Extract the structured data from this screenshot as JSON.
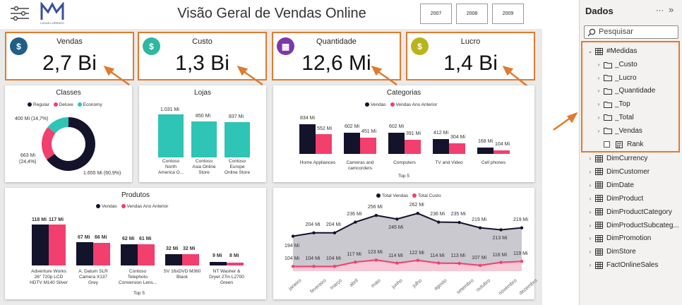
{
  "header": {
    "title": "Visão Geral de Vendas Online",
    "logo_text": "LUKAS LORENZO",
    "years": [
      "2007",
      "2008",
      "2009"
    ]
  },
  "kpis": [
    {
      "label": "Vendas",
      "value": "2,7 Bi",
      "icon": "dollar-icon",
      "color": "#1f5f87"
    },
    {
      "label": "Custo",
      "value": "1,3 Bi",
      "icon": "money-out-icon",
      "color": "#2fb7a0"
    },
    {
      "label": "Quantidade",
      "value": "12,6 Mi",
      "icon": "boxes-icon",
      "color": "#7a3aa8"
    },
    {
      "label": "Lucro",
      "value": "1,4 Bi",
      "icon": "profit-icon",
      "color": "#b7b51a"
    }
  ],
  "colors": {
    "regular": "#13132b",
    "deluxe": "#f23f6d",
    "economy": "#2ec4b6",
    "accent": "#e07b2e",
    "line_area": "#c9c9cf"
  },
  "classes": {
    "title": "Classes",
    "legend": [
      "Regular",
      "Deluxe",
      "Economy"
    ],
    "labels": [
      "400 Mi (14,7%)",
      "663 Mi",
      "(24,4%)",
      "1.655 Mi (60,9%)"
    ]
  },
  "lojas": {
    "title": "Lojas",
    "values": [
      "1.031 Mi",
      "850 Mi",
      "837 Mi"
    ],
    "categories": [
      [
        "Contoso",
        "North",
        "America O..."
      ],
      [
        "Contoso",
        "Asia Online",
        "Store"
      ],
      [
        "Contoso",
        "Europe",
        "Online Store"
      ]
    ]
  },
  "categorias": {
    "title": "Categorias",
    "legend": [
      "Vendas",
      "Vendas Ano Anterior"
    ],
    "groups": [
      {
        "name": [
          "Home Appliances"
        ],
        "a": "834 Mi",
        "b": "552 Mi"
      },
      {
        "name": [
          "Cameras and",
          "camcorders"
        ],
        "a": "602 Mi",
        "b": "451 Mi"
      },
      {
        "name": [
          "Computers"
        ],
        "a": "602 Mi",
        "b": "391 Mi"
      },
      {
        "name": [
          "TV and Video"
        ],
        "a": "412 Mi",
        "b": "304 Mi"
      },
      {
        "name": [
          "Cell phones"
        ],
        "a": "168 Mi",
        "b": "104 Mi"
      }
    ],
    "footer": "Top 5"
  },
  "produtos": {
    "title": "Produtos",
    "legend": [
      "Vendas",
      "Vendas Ano Anterior"
    ],
    "groups": [
      {
        "name": [
          "Adventure Works",
          "26\" 720p LCD",
          "HDTV M140 Silver"
        ],
        "a": "118 Mi",
        "b": "117 Mi"
      },
      {
        "name": [
          "A. Datum SLR",
          "Camera X137",
          "Grey"
        ],
        "a": "67 Mi",
        "b": "66 Mi"
      },
      {
        "name": [
          "Contoso",
          "Telephoto",
          "Conversion Lens..."
        ],
        "a": "62 Mi",
        "b": "61 Mi"
      },
      {
        "name": [
          "SV 16xDVD M360",
          "Black"
        ],
        "a": "32 Mi",
        "b": "32 Mi"
      },
      {
        "name": [
          "NT Washer &",
          "Dryer 27in L2700",
          "Green"
        ],
        "a": "9 Mi",
        "b": "8 Mi"
      }
    ],
    "footer": "Top 5"
  },
  "mensal": {
    "legend": [
      "Total Vendas",
      "Total Custo"
    ],
    "months": [
      "janeiro",
      "fevereiro",
      "março",
      "abril",
      "maio",
      "junho",
      "julho",
      "agosto",
      "setembro",
      "outubro",
      "novembro",
      "dezembro"
    ],
    "vendas_labels": [
      "194 Mi",
      "204 Mi",
      "204 Mi",
      "236 Mi",
      "256 Mi",
      "245 Mi",
      "262 Mi",
      "236 Mi",
      "235 Mi",
      "219 Mi",
      "213 Mi",
      "219 Mi"
    ],
    "custo_labels": [
      "104 Mi",
      "104 Mi",
      "104 Mi",
      "117 Mi",
      "123 Mi",
      "114 Mi",
      "122 Mi",
      "114 Mi",
      "113 Mi",
      "107 Mi",
      "116 Mi",
      "119 Mi"
    ]
  },
  "chart_data": [
    {
      "type": "pie",
      "title": "Classes",
      "categories": [
        "Regular",
        "Deluxe",
        "Economy"
      ],
      "values": [
        1655,
        663,
        400
      ],
      "unit": "Mi"
    },
    {
      "type": "bar",
      "title": "Lojas",
      "categories": [
        "Contoso North America O...",
        "Contoso Asia Online Store",
        "Contoso Europe Online Store"
      ],
      "values": [
        1031,
        850,
        837
      ],
      "unit": "Mi"
    },
    {
      "type": "bar",
      "title": "Categorias",
      "categories": [
        "Home Appliances",
        "Cameras and camcorders",
        "Computers",
        "TV and Video",
        "Cell phones"
      ],
      "series": [
        {
          "name": "Vendas",
          "values": [
            834,
            602,
            602,
            412,
            168
          ]
        },
        {
          "name": "Vendas Ano Anterior",
          "values": [
            552,
            451,
            391,
            304,
            104
          ]
        }
      ],
      "unit": "Mi"
    },
    {
      "type": "bar",
      "title": "Produtos",
      "categories": [
        "Adventure Works 26\" 720p LCD HDTV M140 Silver",
        "A. Datum SLR Camera X137 Grey",
        "Contoso Telephoto Conversion Lens...",
        "SV 16xDVD M360 Black",
        "NT Washer & Dryer 27in L2700 Green"
      ],
      "series": [
        {
          "name": "Vendas",
          "values": [
            118,
            67,
            62,
            32,
            9
          ]
        },
        {
          "name": "Vendas Ano Anterior",
          "values": [
            117,
            66,
            61,
            32,
            8
          ]
        }
      ],
      "unit": "Mi"
    },
    {
      "type": "area",
      "x": [
        "janeiro",
        "fevereiro",
        "março",
        "abril",
        "maio",
        "junho",
        "julho",
        "agosto",
        "setembro",
        "outubro",
        "novembro",
        "dezembro"
      ],
      "series": [
        {
          "name": "Total Vendas",
          "values": [
            194,
            204,
            204,
            236,
            256,
            245,
            262,
            236,
            235,
            219,
            213,
            219
          ]
        },
        {
          "name": "Total Custo",
          "values": [
            104,
            104,
            104,
            117,
            123,
            114,
            122,
            114,
            113,
            107,
            116,
            119
          ]
        }
      ],
      "unit": "Mi"
    }
  ],
  "panel": {
    "title": "Dados",
    "more": "···",
    "collapse": "»",
    "search_placeholder": "Pesquisar",
    "measures_root": "#Medidas",
    "measure_folders": [
      "_Custo",
      "_Lucro",
      "_Quantidade",
      "_Top",
      "_Total",
      "_Vendas"
    ],
    "measure_item": "Rank",
    "tables": [
      "DimCurrency",
      "DimCustomer",
      "DimDate",
      "DimProduct",
      "DimProductCategory",
      "DimProductSubcateg...",
      "DimPromotion",
      "DimStore",
      "FactOnlineSales"
    ]
  }
}
